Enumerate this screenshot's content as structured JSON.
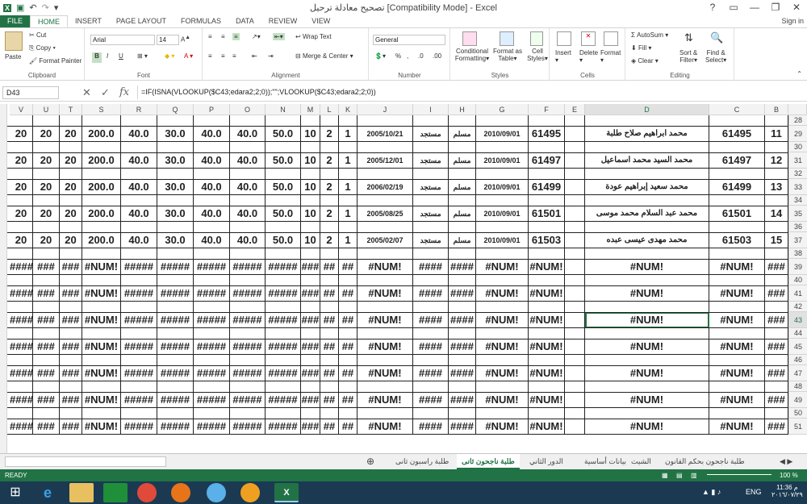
{
  "titlebar": {
    "title": "تصحيح معادلة ترحيل  [Compatibility Mode] - Excel",
    "help": "?",
    "minimize": "—",
    "restore": "❐",
    "close": "✕"
  },
  "tabs": [
    "FILE",
    "HOME",
    "INSERT",
    "PAGE LAYOUT",
    "FORMULAS",
    "DATA",
    "REVIEW",
    "VIEW"
  ],
  "signin": "Sign in",
  "ribbon": {
    "clipboard": {
      "label": "Clipboard",
      "paste": "Paste",
      "cut": "Cut",
      "copy": "Copy",
      "format_painter": "Format Painter"
    },
    "font": {
      "label": "Font",
      "name": "Arial",
      "size": "14",
      "bold": "B",
      "italic": "I",
      "underline": "U"
    },
    "alignment": {
      "label": "Alignment",
      "wrap": "Wrap Text",
      "merge": "Merge & Center"
    },
    "number": {
      "label": "Number",
      "format": "General",
      "percent": "%",
      "comma": ","
    },
    "styles": {
      "label": "Styles",
      "conditional": "Conditional",
      "conditional2": "Formatting",
      "format_as": "Format as",
      "table": "Table",
      "cell": "Cell",
      "styles2": "Styles"
    },
    "cells": {
      "label": "Cells",
      "insert": "Insert",
      "delete": "Delete",
      "format": "Format"
    },
    "editing": {
      "label": "Editing",
      "autosum": "AutoSum",
      "fill": "Fill",
      "clear": "Clear",
      "sort": "Sort &",
      "filter": "Filter",
      "find": "Find &",
      "select": "Select"
    }
  },
  "formula_bar": {
    "name": "D43",
    "fx": "fx",
    "formula": "=IF(ISNA(VLOOKUP($C43;edara2;2;0));\"\";VLOOKUP($C43;edara2;2;0))"
  },
  "columns": [
    "V",
    "U",
    "T",
    "S",
    "R",
    "Q",
    "P",
    "O",
    "N",
    "M",
    "L",
    "K",
    "J",
    "I",
    "H",
    "G",
    "F",
    "E",
    "D",
    "C",
    "B"
  ],
  "rows": [
    {
      "n": "28",
      "tall": false
    },
    {
      "n": "29",
      "tall": true,
      "cells": [
        "20",
        "20",
        "20",
        "200.0",
        "40.0",
        "30.0",
        "40.0",
        "40.0",
        "50.0",
        "10",
        "2",
        "1",
        "2005/10/21",
        "مستجد",
        "مسلم",
        "2010/09/01",
        "61495",
        "",
        "محمد ابراهيم صلاح طلبة",
        "61495",
        "11"
      ]
    },
    {
      "n": "30",
      "tall": false
    },
    {
      "n": "31",
      "tall": true,
      "cells": [
        "20",
        "20",
        "20",
        "200.0",
        "40.0",
        "30.0",
        "40.0",
        "40.0",
        "50.0",
        "10",
        "2",
        "1",
        "2005/12/01",
        "مستجد",
        "مسلم",
        "2010/09/01",
        "61497",
        "",
        "محمد السيد محمد اسماعيل",
        "61497",
        "12"
      ]
    },
    {
      "n": "32",
      "tall": false
    },
    {
      "n": "33",
      "tall": true,
      "cells": [
        "20",
        "20",
        "20",
        "200.0",
        "40.0",
        "30.0",
        "40.0",
        "40.0",
        "50.0",
        "10",
        "2",
        "1",
        "2006/02/19",
        "مستجد",
        "مسلم",
        "2010/09/01",
        "61499",
        "",
        "محمد سعيد إبراهيم عودة",
        "61499",
        "13"
      ]
    },
    {
      "n": "34",
      "tall": false
    },
    {
      "n": "35",
      "tall": true,
      "cells": [
        "20",
        "20",
        "20",
        "200.0",
        "40.0",
        "30.0",
        "40.0",
        "40.0",
        "50.0",
        "10",
        "2",
        "1",
        "2005/08/25",
        "مستجد",
        "مسلم",
        "2010/09/01",
        "61501",
        "",
        "محمد عبد السلام محمد موسى",
        "61501",
        "14"
      ]
    },
    {
      "n": "36",
      "tall": false
    },
    {
      "n": "37",
      "tall": true,
      "cells": [
        "20",
        "20",
        "20",
        "200.0",
        "40.0",
        "30.0",
        "40.0",
        "40.0",
        "50.0",
        "10",
        "2",
        "1",
        "2005/02/07",
        "مستجد",
        "مسلم",
        "2010/09/01",
        "61503",
        "",
        "محمد مهدى عيسى عبده",
        "61503",
        "15"
      ]
    },
    {
      "n": "38",
      "tall": false
    },
    {
      "n": "39",
      "tall": true,
      "cells": [
        "####",
        "###",
        "###",
        "#NUM!",
        "#####",
        "#####",
        "#####",
        "#####",
        "#####",
        "###",
        "##",
        "##",
        "#NUM!",
        "####",
        "####",
        "#NUM!",
        "#NUM!",
        "",
        "#NUM!",
        "#NUM!",
        "###"
      ]
    },
    {
      "n": "40",
      "tall": false
    },
    {
      "n": "41",
      "tall": true,
      "cells": [
        "####",
        "###",
        "###",
        "#NUM!",
        "#####",
        "#####",
        "#####",
        "#####",
        "#####",
        "###",
        "##",
        "##",
        "#NUM!",
        "####",
        "####",
        "#NUM!",
        "#NUM!",
        "",
        "#NUM!",
        "#NUM!",
        "###"
      ]
    },
    {
      "n": "42",
      "tall": false
    },
    {
      "n": "43",
      "tall": true,
      "cells": [
        "####",
        "###",
        "###",
        "#NUM!",
        "#####",
        "#####",
        "#####",
        "#####",
        "#####",
        "###",
        "##",
        "##",
        "#NUM!",
        "####",
        "####",
        "#NUM!",
        "#NUM!",
        "",
        "#NUM!",
        "#NUM!",
        "###"
      ]
    },
    {
      "n": "44",
      "tall": false
    },
    {
      "n": "45",
      "tall": true,
      "cells": [
        "####",
        "###",
        "###",
        "#NUM!",
        "#####",
        "#####",
        "#####",
        "#####",
        "#####",
        "###",
        "##",
        "##",
        "#NUM!",
        "####",
        "####",
        "#NUM!",
        "#NUM!",
        "",
        "#NUM!",
        "#NUM!",
        "###"
      ]
    },
    {
      "n": "46",
      "tall": false
    },
    {
      "n": "47",
      "tall": true,
      "cells": [
        "####",
        "###",
        "###",
        "#NUM!",
        "#####",
        "#####",
        "#####",
        "#####",
        "#####",
        "###",
        "##",
        "##",
        "#NUM!",
        "####",
        "####",
        "#NUM!",
        "#NUM!",
        "",
        "#NUM!",
        "#NUM!",
        "###"
      ]
    },
    {
      "n": "48",
      "tall": false
    },
    {
      "n": "49",
      "tall": true,
      "cells": [
        "####",
        "###",
        "###",
        "#NUM!",
        "#####",
        "#####",
        "#####",
        "#####",
        "#####",
        "###",
        "##",
        "##",
        "#NUM!",
        "####",
        "####",
        "#NUM!",
        "#NUM!",
        "",
        "#NUM!",
        "#NUM!",
        "###"
      ]
    },
    {
      "n": "50",
      "tall": false
    },
    {
      "n": "51",
      "tall": true,
      "cells": [
        "####",
        "###",
        "###",
        "#NUM!",
        "#####",
        "#####",
        "#####",
        "#####",
        "#####",
        "###",
        "##",
        "##",
        "#NUM!",
        "####",
        "####",
        "#NUM!",
        "#NUM!",
        "",
        "#NUM!",
        "#NUM!",
        "###"
      ]
    }
  ],
  "sheet_tabs": [
    "طلبة ناجحون بحكم القانون",
    "الشيت",
    "بيانات أساسية",
    "الدور الثاني",
    "طلبة ناجحون ثانى",
    "طلبة راسبون ثانى"
  ],
  "active_sheet": "طلبة ناجحون ثانى",
  "status": {
    "ready": "READY",
    "zoom": "100 %"
  },
  "taskbar": {
    "lang": "ENG",
    "time": "11:36 م",
    "date": "٢٠١٦/٠٧/٢٩"
  },
  "colors": {
    "excel_green": "#217346",
    "taskbar": "#1b3a52"
  }
}
